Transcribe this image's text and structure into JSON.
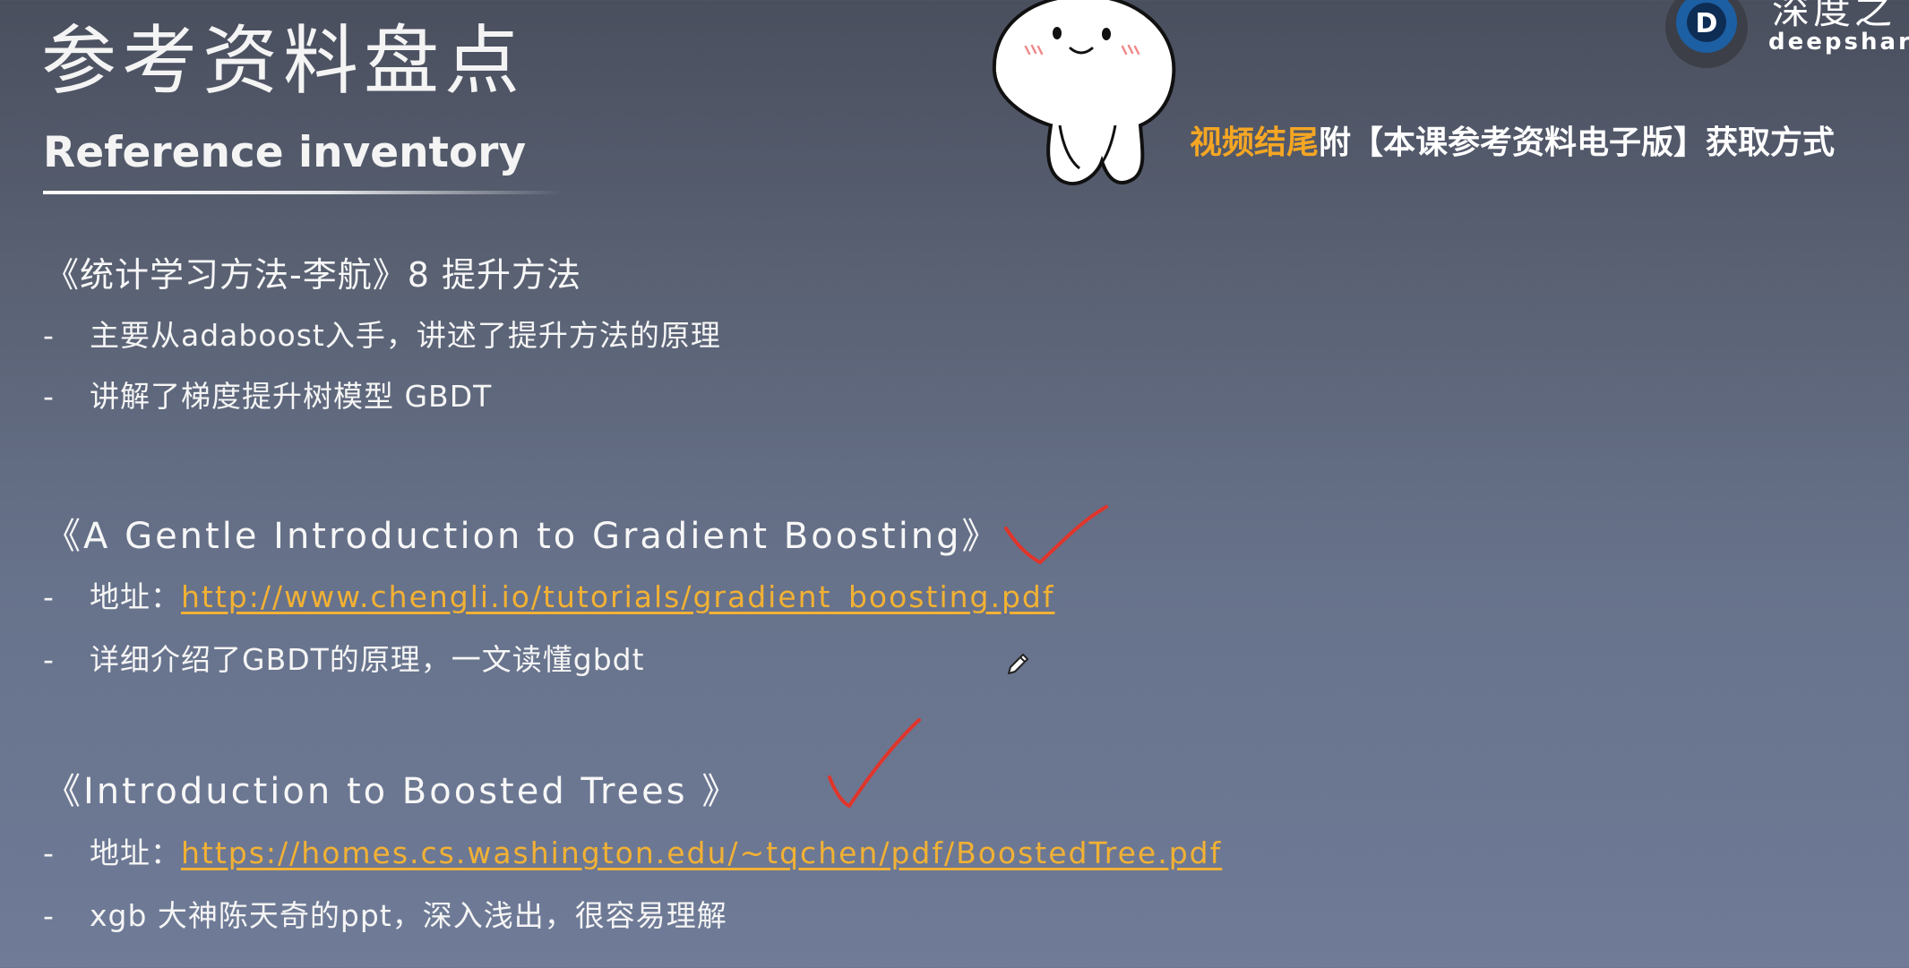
{
  "header": {
    "title_cn": "参考资料盘点",
    "title_en": "Reference inventory"
  },
  "promo": {
    "highlight": "视频结尾",
    "rest": "附【本课参考资料电子版】获取方式"
  },
  "logo": {
    "text_cn": "深度之",
    "text_en": "deepshare.",
    "mark": "D"
  },
  "sections": [
    {
      "title": "《统计学习方法-李航》8 提升方法",
      "bullets": [
        {
          "dash": "-",
          "text": "主要从adaboost入手，讲述了提升方法的原理"
        },
        {
          "dash": "-",
          "text": "讲解了梯度提升树模型 GBDT"
        }
      ]
    },
    {
      "title": "《A Gentle Introduction to Gradient Boosting》",
      "bullets": [
        {
          "dash": "-",
          "label": "地址：",
          "link": "http://www.chengli.io/tutorials/gradient_boosting.pdf"
        },
        {
          "dash": "-",
          "text": "详细介绍了GBDT的原理，一文读懂gbdt"
        }
      ]
    },
    {
      "title": "《Introduction to Boosted Trees 》",
      "bullets": [
        {
          "dash": "-",
          "label": "地址：",
          "link": "https://homes.cs.washington.edu/~tqchen/pdf/BoostedTree.pdf"
        },
        {
          "dash": "-",
          "text": "xgb 大神陈天奇的ppt，深入浅出，很容易理解"
        }
      ]
    }
  ],
  "annotations": {
    "checkmark_color": "#e0352b",
    "link_color": "#f2b134",
    "highlight_color": "#f5a623",
    "icons": [
      "mascot-illustration",
      "checkmark-icon",
      "pencil-cursor-icon",
      "logo-eye-icon"
    ]
  }
}
